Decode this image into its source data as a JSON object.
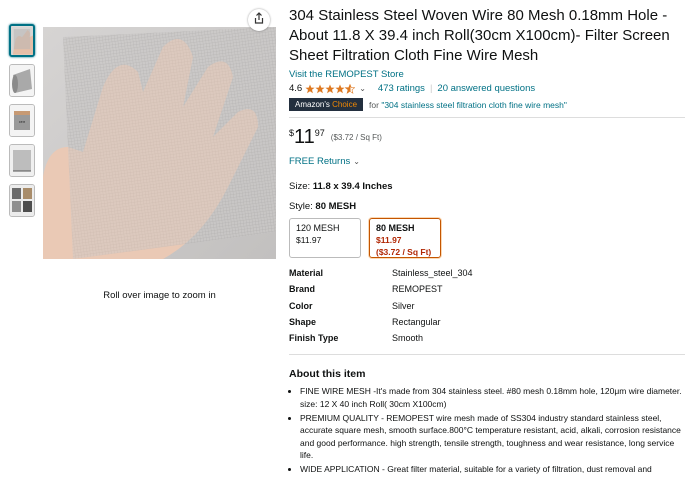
{
  "gallery": {
    "thumbnails": [
      "mesh-in-hand",
      "mesh-roll",
      "mesh-tube",
      "mesh-sheet",
      "mesh-uses"
    ],
    "zoom_hint": "Roll over image to zoom in"
  },
  "product": {
    "title": "304 Stainless Steel Woven Wire 80 Mesh 0.18mm Hole - About 11.8 X 39.4 inch Roll(30cm X100cm)- Filter Screen Sheet Filtration Cloth Fine Wire Mesh",
    "store_link": "Visit the REMOPEST Store",
    "rating": "4.6",
    "rating_stars": 4.5,
    "ratings_count": "473 ratings",
    "answered_questions": "20 answered questions",
    "choice_badge_prefix": "Amazon's",
    "choice_badge_suffix": "Choice",
    "choice_for": "for",
    "choice_query": "\"304 stainless steel filtration cloth fine wire mesh\"",
    "price_symbol": "$",
    "price_whole": "11",
    "price_fraction": "97",
    "unit_price": "($3.72 / Sq Ft)",
    "free_returns": "FREE Returns",
    "size_label": "Size:",
    "size_value": "11.8 x 39.4 Inches",
    "style_label": "Style:",
    "style_value": "80 MESH",
    "options": [
      {
        "name": "120 MESH",
        "price": "$11.97",
        "unit": ""
      },
      {
        "name": "80 MESH",
        "price": "$11.97",
        "unit": "($3.72 / Sq Ft)"
      }
    ],
    "specs": [
      {
        "key": "Material",
        "value": "Stainless_steel_304"
      },
      {
        "key": "Brand",
        "value": "REMOPEST"
      },
      {
        "key": "Color",
        "value": "Silver"
      },
      {
        "key": "Shape",
        "value": "Rectangular"
      },
      {
        "key": "Finish Type",
        "value": "Smooth"
      }
    ],
    "about_title": "About this item",
    "bullets": [
      "FINE WIRE MESH -It's made from 304 stainless steel. #80 mesh 0.18mm hole, 120μm wire diameter. size: 12 X 40 inch Roll( 30cm X100cm)",
      "PREMIUM QUALITY - REMOPEST wire mesh made of SS304 industry standard stainless steel, accurate square mesh, smooth surface.800°C temperature resistant, acid, alkali, corrosion resistance and good performance. high strength, tensile strength, toughness and wear resistance, long service life.",
      "WIDE APPLICATION - Great filter material, suitable for a variety of filtration, dust removal and"
    ]
  },
  "colors": {
    "link": "#007185",
    "star": "#de7921",
    "badge_bg": "#232f3e",
    "selected_border": "#c45500",
    "deal_price": "#b12704"
  }
}
